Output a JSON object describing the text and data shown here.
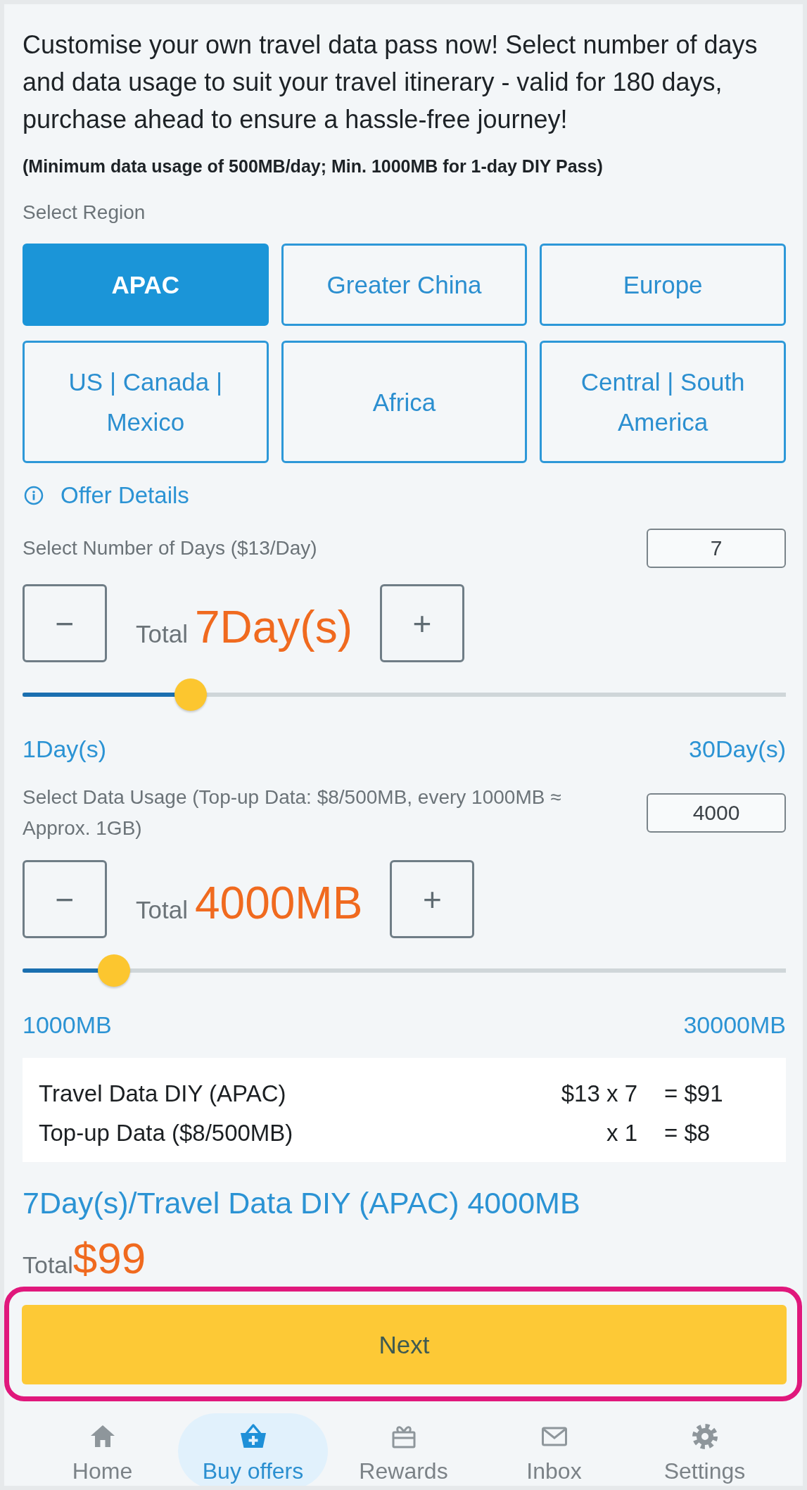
{
  "intro": {
    "text": "Customise your own travel data pass now! Select number of days and data usage to suit your travel itinerary - valid for 180 days, purchase ahead to ensure a hassle-free journey!",
    "note": "(Minimum data usage of 500MB/day; Min. 1000MB for 1-day DIY Pass)"
  },
  "region": {
    "label": "Select Region",
    "options": [
      {
        "label": "APAC",
        "selected": true
      },
      {
        "label": "Greater China",
        "selected": false
      },
      {
        "label": "Europe",
        "selected": false
      },
      {
        "label": "US | Canada | Mexico",
        "selected": false
      },
      {
        "label": "Africa",
        "selected": false
      },
      {
        "label": "Central | South America",
        "selected": false
      }
    ],
    "offer_details": "Offer Details"
  },
  "pickers": [
    {
      "label": "Select Number of Days ($13/Day)",
      "value": "7",
      "minus": "−",
      "total_label": "Total",
      "total": "7Day(s)",
      "plus": "+",
      "level": 0.22,
      "min_label": "1Day(s)",
      "max_label": "30Day(s)"
    },
    {
      "label": "Select Data Usage (Top-up Data: $8/500MB, every 1000MB ≈ Approx. 1GB)",
      "value": "4000",
      "minus": "−",
      "total_label": "Total",
      "total": "4000MB",
      "plus": "+",
      "level": 0.12,
      "min_label": "1000MB",
      "max_label": "30000MB"
    }
  ],
  "summary": [
    {
      "item": "Travel Data DIY (APAC)",
      "quantity": "$13 x 7",
      "amount": "= $91"
    },
    {
      "item": "Top-up Data ($8/500MB)",
      "quantity": "x 1",
      "amount": "= $8"
    }
  ],
  "product": "7Day(s)/Travel Data DIY (APAC) 4000MB",
  "total": {
    "label": "Total",
    "amount": "$99"
  },
  "next_button": {
    "label": "Next",
    "highlighted": true
  },
  "nav": [
    {
      "label": "Home",
      "selected": false
    },
    {
      "label": "Buy offers",
      "selected": true
    },
    {
      "label": "Rewards",
      "selected": false
    },
    {
      "label": "Inbox",
      "selected": false
    },
    {
      "label": "Settings",
      "selected": false
    }
  ]
}
